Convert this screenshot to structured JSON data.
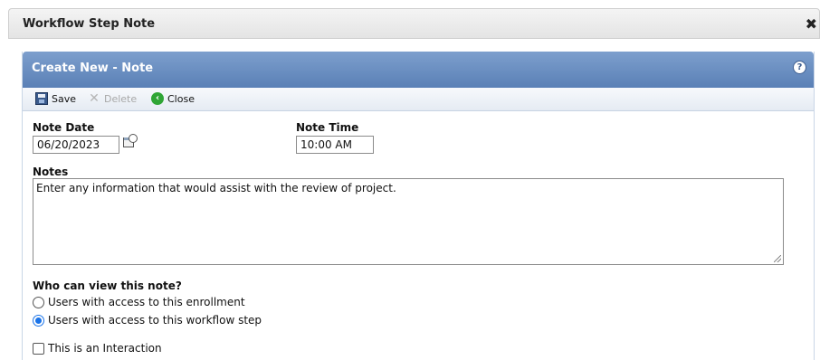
{
  "dialog": {
    "title": "Workflow Step Note",
    "close_glyph": "✖"
  },
  "panel": {
    "title": "Create New - Note",
    "help_glyph": "?"
  },
  "toolbar": {
    "save_label": "Save",
    "delete_label": "Delete",
    "close_label": "Close"
  },
  "form": {
    "note_date_label": "Note Date",
    "note_date_value": "06/20/2023",
    "note_time_label": "Note Time",
    "note_time_value": "10:00 AM",
    "notes_label": "Notes",
    "notes_value": "Enter any information that would assist with the review of project.",
    "visibility_label": "Who can view this note?",
    "visibility_options": [
      {
        "label": "Users with access to this enrollment",
        "selected": false
      },
      {
        "label": "Users with access to this workflow step",
        "selected": true
      }
    ],
    "interaction_label": "This is an Interaction",
    "interaction_checked": false
  },
  "icons": {
    "save": "save-icon",
    "delete": "delete-icon",
    "close": "close-icon",
    "calendar": "calendar-clock-icon",
    "help": "help-icon"
  },
  "colors": {
    "panel_header": "#6a8ec2",
    "close_green": "#2fa535",
    "radio_selected": "#1a73e8"
  }
}
